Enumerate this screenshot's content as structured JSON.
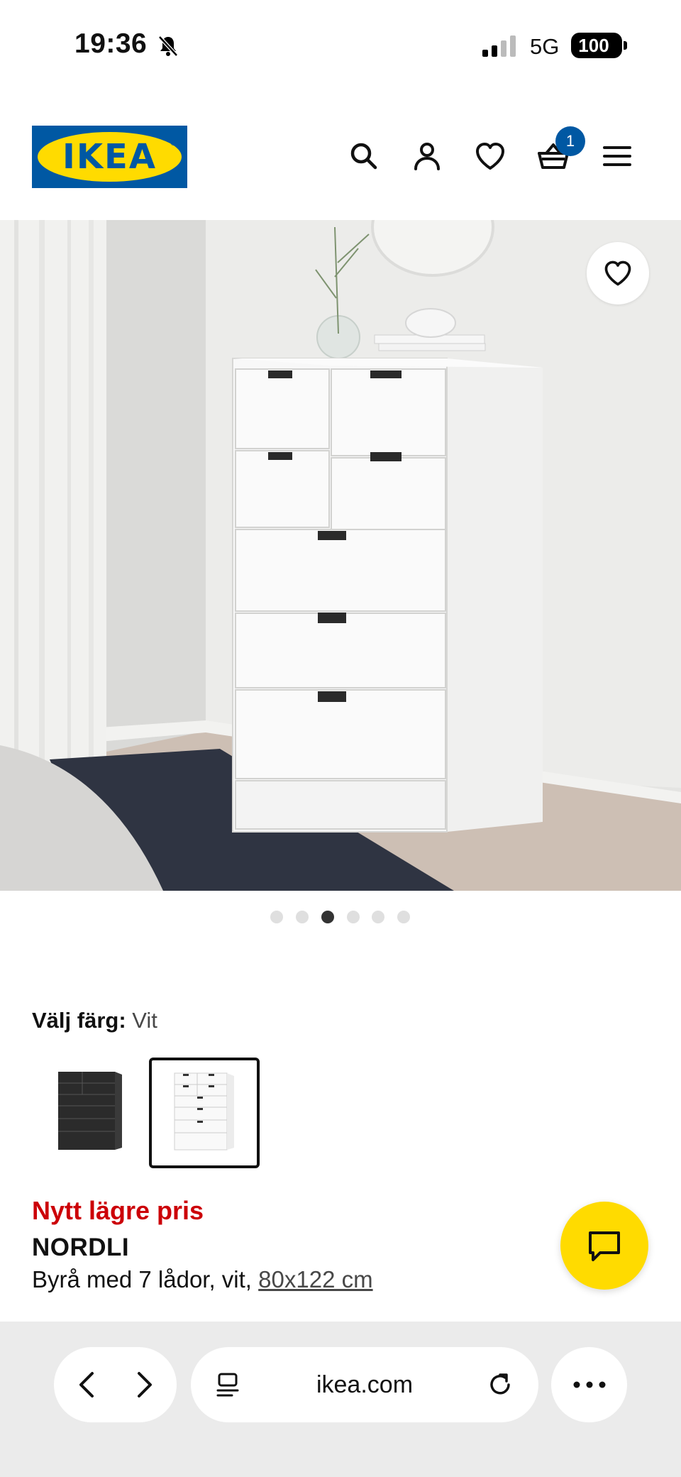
{
  "status_bar": {
    "time": "19:36",
    "network": "5G",
    "battery": "100"
  },
  "header": {
    "logo_text": "IKEA",
    "cart_count": "1",
    "icons": [
      "search-icon",
      "account-icon",
      "heart-icon",
      "cart-icon",
      "menu-icon"
    ]
  },
  "gallery": {
    "image_count": 6,
    "active_index": 2
  },
  "color_picker": {
    "label": "Välj färg:",
    "selected_value": "Vit",
    "options": [
      "Antracit",
      "Vit"
    ]
  },
  "product": {
    "promo": "Nytt lägre pris",
    "name": "NORDLI",
    "description": "Byrå med 7 lådor, vit,",
    "size": "80x122 cm"
  },
  "browser": {
    "url": "ikea.com"
  },
  "colors": {
    "ikea_blue": "#0058a3",
    "ikea_yellow": "#ffdb00",
    "promo_red": "#cc0008"
  }
}
